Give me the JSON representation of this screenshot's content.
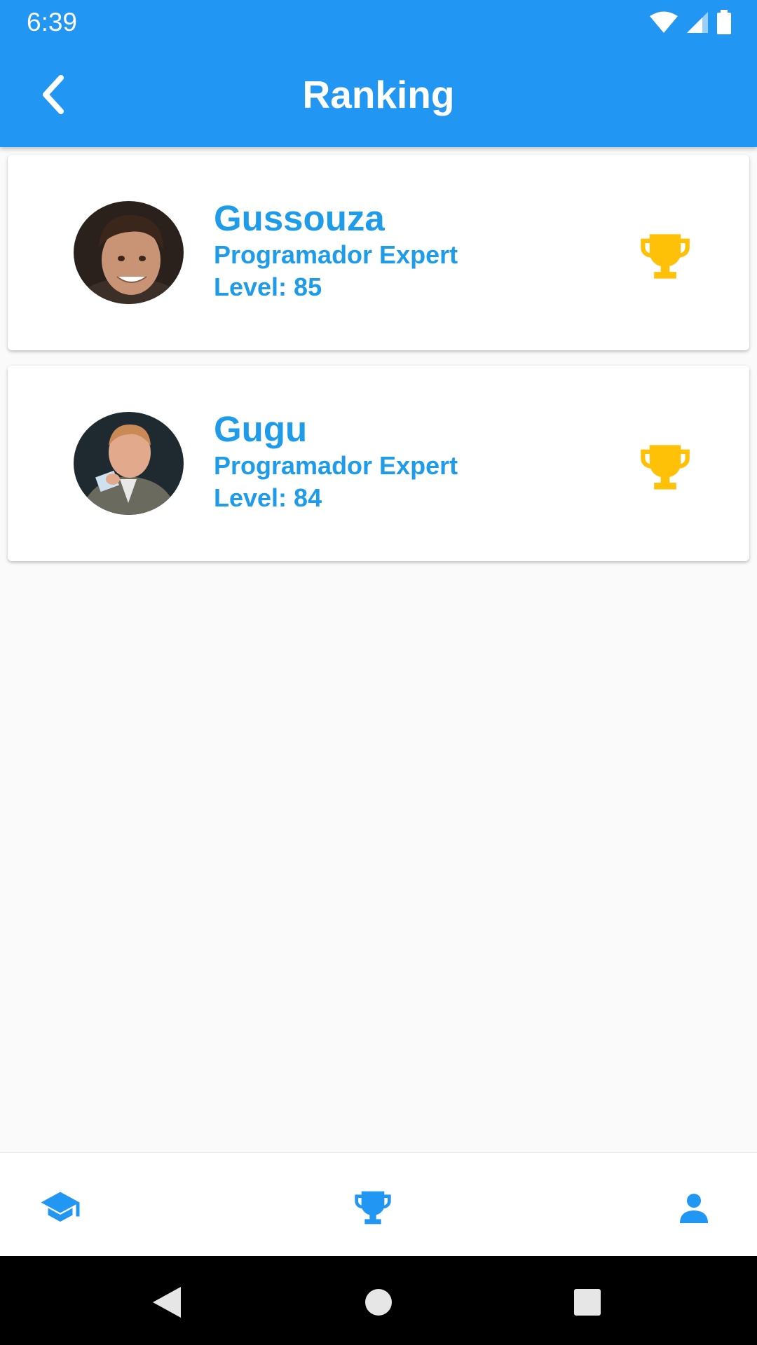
{
  "status_bar": {
    "time": "6:39"
  },
  "app_bar": {
    "title": "Ranking"
  },
  "ranking": [
    {
      "name": "Gussouza",
      "role": "Programador Expert",
      "level": "Level: 85"
    },
    {
      "name": "Gugu",
      "role": "Programador Expert",
      "level": "Level: 84"
    }
  ],
  "colors": {
    "primary": "#2196F3",
    "text_accent": "#1E9BE9",
    "trophy": "#FFC107",
    "background": "#FAFAFA"
  },
  "icons": {
    "back": "arrow-back-icon",
    "trophy": "trophy-icon",
    "nav": [
      "graduation-cap-icon",
      "trophy-icon",
      "person-icon"
    ],
    "system": [
      "back-triangle-icon",
      "home-circle-icon",
      "recents-square-icon"
    ]
  }
}
